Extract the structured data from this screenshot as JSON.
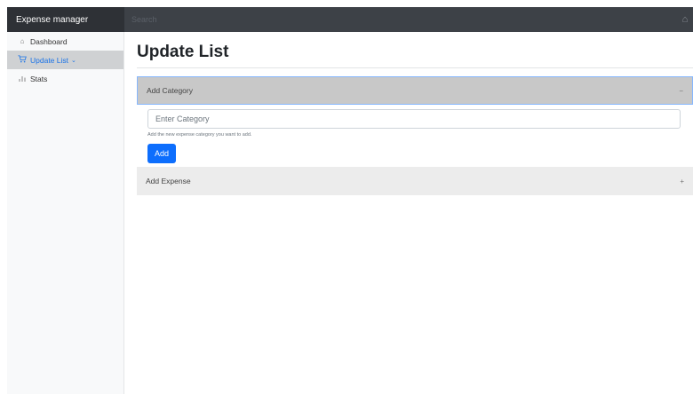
{
  "header": {
    "brand": "Expense manager",
    "search_placeholder": "Search",
    "right_icon": "home-icon"
  },
  "sidebar": {
    "items": [
      {
        "label": "Dashboard",
        "icon": "home-icon",
        "active": false
      },
      {
        "label": "Update List",
        "icon": "cart-icon",
        "active": true,
        "caret": "⌄"
      },
      {
        "label": "Stats",
        "icon": "bar-chart-icon",
        "active": false
      }
    ]
  },
  "main": {
    "title": "Update List",
    "sections": [
      {
        "title": "Add Category",
        "toggle": "−",
        "expanded": true,
        "input_placeholder": "Enter Category",
        "help_text": "Add the new expense category you want to add.",
        "button_label": "Add"
      },
      {
        "title": "Add Expense",
        "toggle": "+",
        "expanded": false
      }
    ]
  },
  "colors": {
    "topbar": "#3d4147",
    "brand_bg": "#2e3136",
    "sidebar_active_bg": "#cfd1d3",
    "accent": "#1a73e8",
    "button": "#0d6efd"
  }
}
